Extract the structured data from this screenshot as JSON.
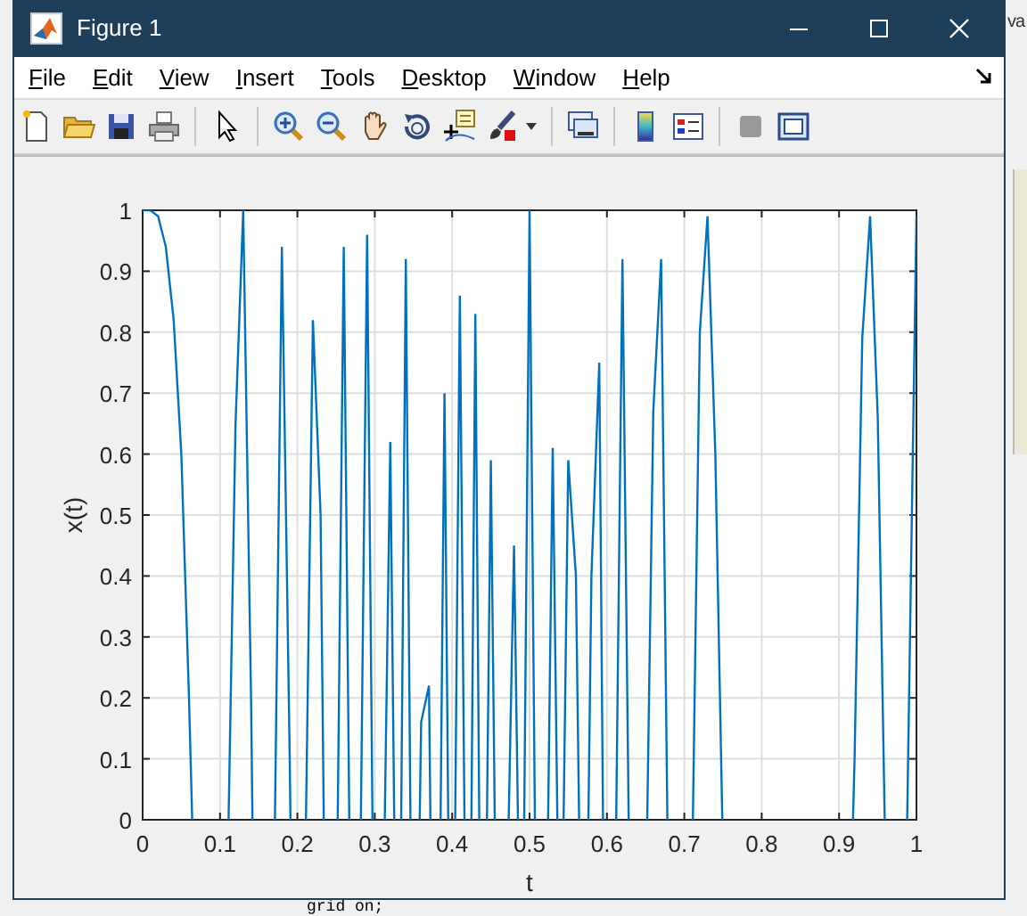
{
  "background": {
    "right_text": "va",
    "editor_text": "grid on;"
  },
  "window": {
    "title": "Figure 1"
  },
  "menu": [
    {
      "label": "File"
    },
    {
      "label": "Edit"
    },
    {
      "label": "View"
    },
    {
      "label": "Insert"
    },
    {
      "label": "Tools"
    },
    {
      "label": "Desktop"
    },
    {
      "label": "Window"
    },
    {
      "label": "Help"
    }
  ],
  "toolbar": [
    {
      "kind": "new"
    },
    {
      "kind": "open"
    },
    {
      "kind": "save"
    },
    {
      "kind": "print"
    },
    {
      "kind": "sep"
    },
    {
      "kind": "pointer"
    },
    {
      "kind": "sep"
    },
    {
      "kind": "zoom-in"
    },
    {
      "kind": "zoom-out"
    },
    {
      "kind": "pan"
    },
    {
      "kind": "rotate"
    },
    {
      "kind": "cursor"
    },
    {
      "kind": "brush"
    },
    {
      "kind": "sep"
    },
    {
      "kind": "link"
    },
    {
      "kind": "sep"
    },
    {
      "kind": "colorbar"
    },
    {
      "kind": "legend"
    },
    {
      "kind": "sep"
    },
    {
      "kind": "hide"
    },
    {
      "kind": "show"
    }
  ],
  "figure": {
    "chart_data": {
      "type": "line",
      "grid": true,
      "xlabel": "t",
      "ylabel": "x(t)",
      "xlim": [
        0,
        1
      ],
      "ylim": [
        0,
        1
      ],
      "xticks": [
        0,
        0.1,
        0.2,
        0.3,
        0.4,
        0.5,
        0.6,
        0.7,
        0.8,
        0.9,
        1
      ],
      "yticks": [
        0,
        0.1,
        0.2,
        0.3,
        0.4,
        0.5,
        0.6,
        0.7,
        0.8,
        0.9,
        1
      ],
      "x": [
        0,
        0.01,
        0.02,
        0.03,
        0.04,
        0.05,
        0.06,
        0.064,
        0.111,
        0.12,
        0.13,
        0.14,
        0.142,
        0.171,
        0.18,
        0.19,
        0.191,
        0.211,
        0.22,
        0.23,
        0.234,
        0.252,
        0.26,
        0.267,
        0.282,
        0.29,
        0.297,
        0.313,
        0.32,
        0.325,
        0.334,
        0.34,
        0.346,
        0.358,
        0.36,
        0.37,
        0.372,
        0.385,
        0.39,
        0.395,
        0.404,
        0.41,
        0.416,
        0.425,
        0.43,
        0.435,
        0.445,
        0.45,
        0.455,
        0.473,
        0.48,
        0.485,
        0.493,
        0.5,
        0.507,
        0.524,
        0.53,
        0.536,
        0.544,
        0.55,
        0.56,
        0.564,
        0.576,
        0.58,
        0.59,
        0.595,
        0.612,
        0.62,
        0.628,
        0.652,
        0.66,
        0.67,
        0.678,
        0.711,
        0.72,
        0.73,
        0.74,
        0.749,
        0.918,
        0.92,
        0.93,
        0.94,
        0.95,
        0.959,
        0.988,
        1
      ],
      "series": [
        {
          "color": "#0072bd",
          "values": [
            1,
            1,
            0.99,
            0.94,
            0.82,
            0.6,
            0.2,
            0,
            0,
            0.65,
            1,
            0.2,
            0,
            0,
            0.94,
            0.1,
            0,
            0,
            0.82,
            0.5,
            0,
            0,
            0.94,
            0,
            0,
            0.96,
            0,
            0,
            0.62,
            0,
            0,
            0.92,
            0,
            0,
            0.16,
            0.22,
            0,
            0,
            0.7,
            0,
            0,
            0.86,
            0,
            0,
            0.83,
            0,
            0,
            0.59,
            0,
            0,
            0.45,
            0,
            0,
            1,
            0,
            0,
            0.61,
            0,
            0,
            0.59,
            0.4,
            0,
            0,
            0.4,
            0.75,
            0,
            0,
            0.92,
            0,
            0,
            0.67,
            0.92,
            0,
            0,
            0.8,
            0.99,
            0.6,
            0,
            0,
            0.1,
            0.79,
            0.99,
            0.66,
            0,
            0,
            0.99
          ]
        }
      ]
    }
  }
}
